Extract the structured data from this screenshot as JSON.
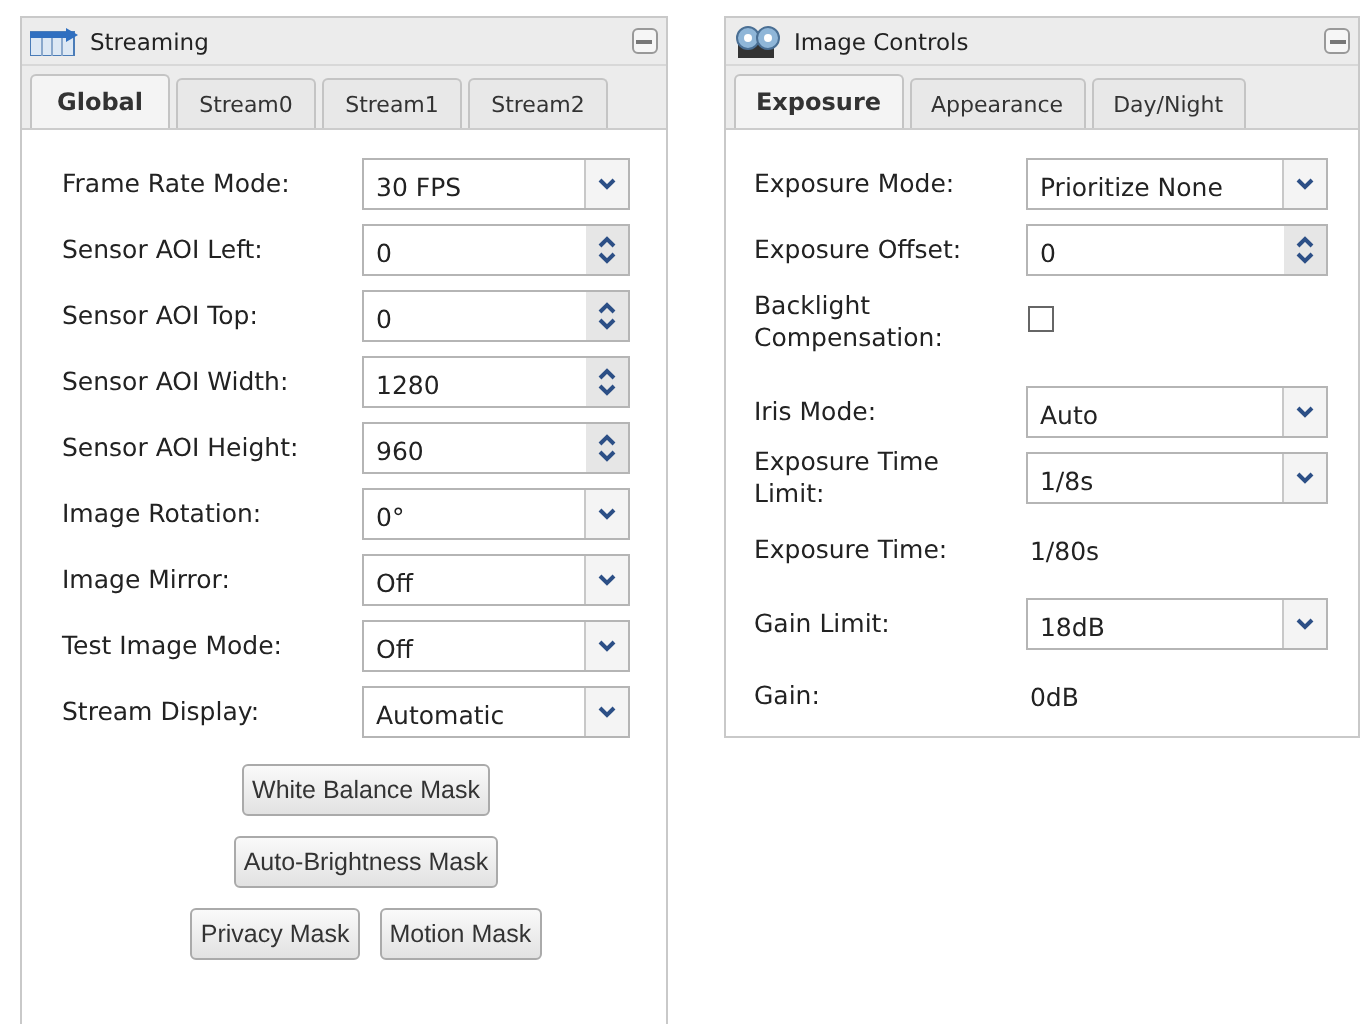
{
  "panels": [
    {
      "title": "Streaming",
      "tabs": [
        {
          "label": "Global",
          "selected": true
        },
        {
          "label": "Stream0",
          "selected": false
        },
        {
          "label": "Stream1",
          "selected": false
        },
        {
          "label": "Stream2",
          "selected": false
        }
      ],
      "fields": [
        {
          "kind": "select",
          "label": "Frame Rate Mode:",
          "value": "30 FPS"
        },
        {
          "kind": "spinner",
          "label": "Sensor AOI Left:",
          "value": "0"
        },
        {
          "kind": "spinner",
          "label": "Sensor AOI Top:",
          "value": "0"
        },
        {
          "kind": "spinner",
          "label": "Sensor AOI Width:",
          "value": "1280"
        },
        {
          "kind": "spinner",
          "label": "Sensor AOI Height:",
          "value": "960"
        },
        {
          "kind": "select",
          "label": "Image Rotation:",
          "value": "0°"
        },
        {
          "kind": "select",
          "label": "Image Mirror:",
          "value": "Off"
        },
        {
          "kind": "select",
          "label": "Test Image Mode:",
          "value": "Off"
        },
        {
          "kind": "select",
          "label": "Stream Display:",
          "value": "Automatic"
        }
      ],
      "button_rows": [
        [
          "White Balance Mask"
        ],
        [
          "Auto-Brightness Mask"
        ],
        [
          "Privacy Mask",
          "Motion Mask"
        ]
      ]
    },
    {
      "title": "Image Controls",
      "tabs": [
        {
          "label": "Exposure",
          "selected": true
        },
        {
          "label": "Appearance",
          "selected": false
        },
        {
          "label": "Day/Night",
          "selected": false
        }
      ],
      "fields": [
        {
          "kind": "select",
          "label": "Exposure Mode:",
          "value": "Prioritize None"
        },
        {
          "kind": "spinner",
          "label": "Exposure Offset:",
          "value": "0"
        },
        {
          "kind": "checkbox",
          "label": "Backlight Compensation:",
          "checked": false
        },
        {
          "kind": "select",
          "label": "Iris Mode:",
          "value": "Auto"
        },
        {
          "kind": "select",
          "label": "Exposure Time Limit:",
          "value": "1/8s"
        },
        {
          "kind": "text",
          "label": "Exposure Time:",
          "value": "1/80s"
        },
        {
          "kind": "select",
          "label": "Gain Limit:",
          "value": "18dB"
        },
        {
          "kind": "text",
          "label": "Gain:",
          "value": "0dB"
        }
      ]
    }
  ]
}
